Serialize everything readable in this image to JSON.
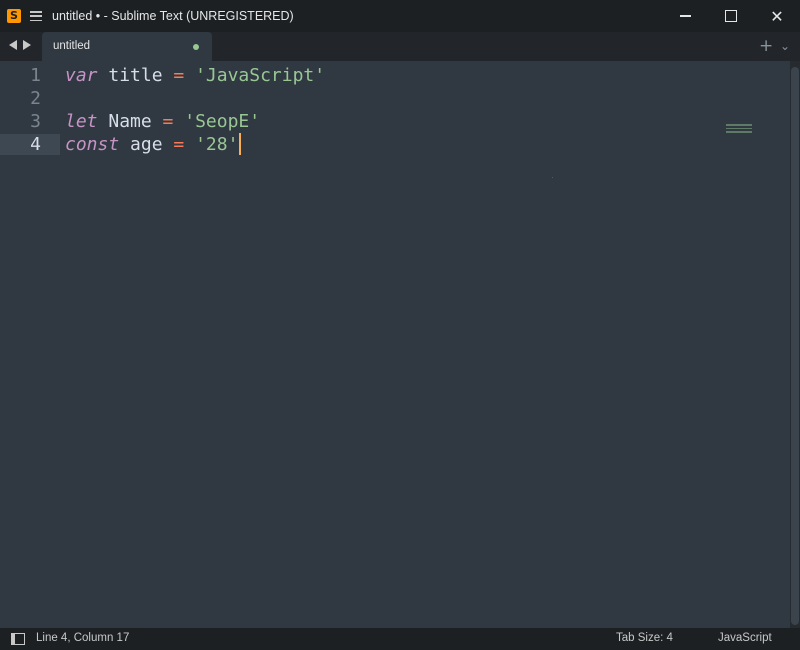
{
  "window": {
    "title": "untitled • - Sublime Text (UNREGISTERED)",
    "app_icon_letter": "S",
    "controls": [
      "minimize",
      "maximize",
      "close"
    ]
  },
  "tabs": [
    {
      "label": "untitled",
      "modified": true,
      "active": true
    }
  ],
  "tabbar": {
    "new_tab_icon": "+",
    "list_icon": "⌄"
  },
  "editor": {
    "lines": [
      {
        "number": "1",
        "tokens": [
          {
            "t": "kw",
            "v": "var"
          },
          {
            "t": "id",
            "v": " title "
          },
          {
            "t": "op",
            "v": "="
          },
          {
            "t": "id",
            "v": " "
          },
          {
            "t": "str",
            "v": "'JavaScript'"
          }
        ]
      },
      {
        "number": "2",
        "tokens": []
      },
      {
        "number": "3",
        "tokens": [
          {
            "t": "kw",
            "v": "let"
          },
          {
            "t": "id",
            "v": " Name "
          },
          {
            "t": "op",
            "v": "="
          },
          {
            "t": "id",
            "v": " "
          },
          {
            "t": "str",
            "v": "'SeopE'"
          }
        ]
      },
      {
        "number": "4",
        "tokens": [
          {
            "t": "kw",
            "v": "const"
          },
          {
            "t": "id",
            "v": " age "
          },
          {
            "t": "op",
            "v": "="
          },
          {
            "t": "id",
            "v": " "
          },
          {
            "t": "str",
            "v": "'28'"
          }
        ],
        "current": true
      }
    ],
    "colors": {
      "background": "#303841",
      "keyword": "#c594c5",
      "operator": "#f97b58",
      "string": "#99c794",
      "caret": "#f9ae58"
    }
  },
  "status": {
    "position": "Line 4, Column 17",
    "tab_size": "Tab Size: 4",
    "syntax": "JavaScript"
  }
}
